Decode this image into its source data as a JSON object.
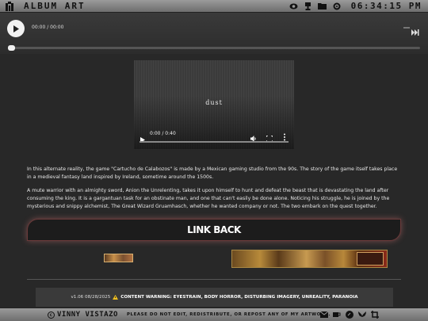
{
  "topbar": {
    "title": "ALBUM ART",
    "clock": "06:34:15 PM",
    "icons": [
      "eye-icon",
      "trophy-icon",
      "folder-icon",
      "gear-icon"
    ]
  },
  "audio": {
    "time": "00:00 / 00:00",
    "icons": [
      "play-icon",
      "volume-icon",
      "skip-forward-icon"
    ],
    "progress": 0
  },
  "video": {
    "caption": "dust",
    "time": "0:00 / 0:40",
    "icons": [
      "play-icon",
      "volume-icon",
      "fullscreen-icon",
      "more-icon"
    ],
    "progress": 0
  },
  "content": {
    "paragraph1": "In this alternate reality, the game \"Cartucho de Calabozos\" is made by a Mexican gaming studio from the 90s. The story of the game itself takes place in a medieval fantasy land inspired by Ireland, sometime around the 1500s.",
    "paragraph2": "A mute warrior with an almighty sword, Anion the Unrelenting, takes it upon himself to hunt and defeat the beast that is devastating the land after consuming the king. It is a gargantuan task for an obstinate man, and one that can't easily be done alone. Noticing his struggle, he is joined by the mysterious and snippy alchemist, The Great Wizard Gruamhasch, whether he wanted company or not. The two embark on the quest together."
  },
  "link_back": {
    "label": "LINK BACK"
  },
  "footer": {
    "version": "v1.06 08/28/2025",
    "warning": "CONTENT WARNING: EYESTRAIN, BODY HORROR, DISTURBING IMAGERY, UNREALITY, PARANOIA"
  },
  "bottombar": {
    "author": "VINNY VISTAZO",
    "notice": "PLEASE DO NOT EDIT, REDISTRIBUTE, OR REPOST ANY OF MY ARTWORK.",
    "icons": [
      "mail-icon",
      "coffee-icon",
      "discord-icon",
      "bluesky-icon",
      "crop-icon"
    ]
  },
  "colors": {
    "bar_gray": "#8a8a8a",
    "background": "#282828",
    "link_glow": "#dc7878",
    "warning_yellow": "#f0c020"
  }
}
